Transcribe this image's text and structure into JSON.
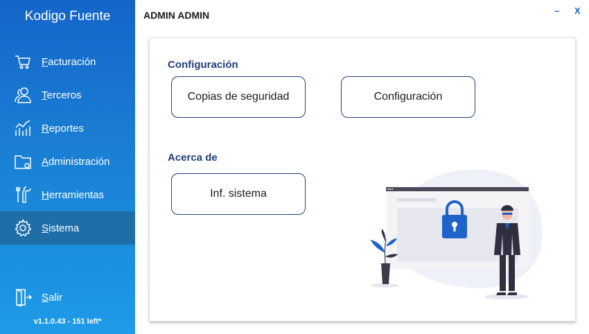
{
  "app": {
    "title": "Kodigo Fuente",
    "version": "v1.1.0.43 - 151 left*"
  },
  "window": {
    "user_title": "ADMIN ADMIN",
    "minimize_label": "–",
    "close_label": "X"
  },
  "sidebar": {
    "items": [
      {
        "label": "Facturación",
        "icon": "cart-icon",
        "active": false
      },
      {
        "label": "Terceros",
        "icon": "users-icon",
        "active": false
      },
      {
        "label": "Reportes",
        "icon": "chart-icon",
        "active": false
      },
      {
        "label": "Administración",
        "icon": "folder-icon",
        "active": false
      },
      {
        "label": "Herramientas",
        "icon": "tools-icon",
        "active": false
      },
      {
        "label": "Sistema",
        "icon": "gear-icon",
        "active": true
      }
    ],
    "exit_label": "Salir"
  },
  "main": {
    "config_section": {
      "title": "Configuración",
      "buttons": [
        "Copias de seguridad",
        "Configuración"
      ]
    },
    "about_section": {
      "title": "Acerca de",
      "buttons": [
        "Inf. sistema"
      ]
    }
  },
  "colors": {
    "sidebar_top": "#1565c8",
    "sidebar_bottom": "#1e9be8",
    "active_item": "#1f6ea8",
    "accent": "#1f3f7a",
    "lock_blue": "#1e63c8"
  }
}
